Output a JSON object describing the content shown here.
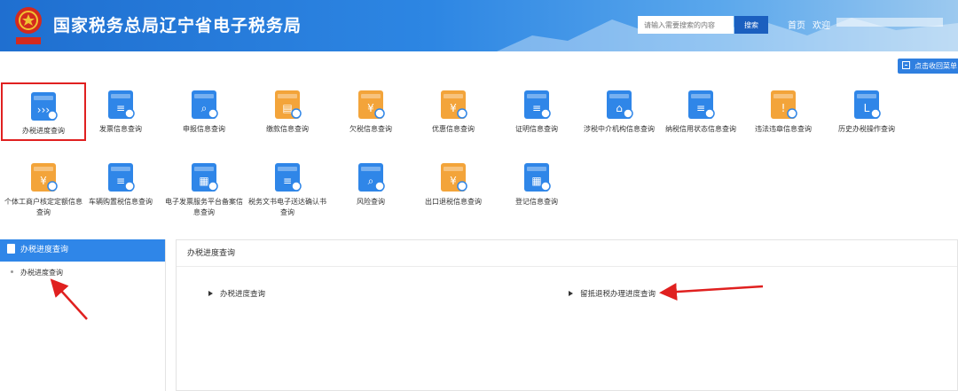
{
  "header": {
    "title": "国家税务总局辽宁省电子税务局",
    "emblem_text": "国家税务",
    "search_placeholder": "请输入需要搜索的内容",
    "search_button": "搜索",
    "nav_home": "首页",
    "nav_welcome": "欢迎"
  },
  "collapse_label": "点击收回菜单",
  "grid_items": [
    {
      "label": "办税进度查询",
      "icon": "progress-query-icon",
      "selected": true
    },
    {
      "label": "发票信息查询",
      "icon": "invoice-query-icon"
    },
    {
      "label": "申报信息查询",
      "icon": "declaration-query-icon"
    },
    {
      "label": "缴款信息查询",
      "icon": "payment-query-icon"
    },
    {
      "label": "欠税信息查询",
      "icon": "tax-arrears-query-icon"
    },
    {
      "label": "优惠信息查询",
      "icon": "preferential-query-icon"
    },
    {
      "label": "证明信息查询",
      "icon": "certificate-query-icon"
    },
    {
      "label": "涉税中介机构信息查询",
      "icon": "tax-agency-query-icon"
    },
    {
      "label": "纳税信用状态信息查询",
      "icon": "credit-status-query-icon"
    },
    {
      "label": "违法违章信息查询",
      "icon": "violation-query-icon"
    },
    {
      "label": "历史办税操作查询",
      "icon": "history-operation-icon"
    },
    {
      "label": "个体工商户核定定额信息查询",
      "icon": "individual-business-icon"
    },
    {
      "label": "车辆购置税信息查询",
      "icon": "vehicle-tax-icon"
    },
    {
      "label": "电子发票服务平台备案信息查询",
      "icon": "e-invoice-filing-icon"
    },
    {
      "label": "税务文书电子送达确认书查询",
      "icon": "e-delivery-document-icon"
    },
    {
      "label": "风险查询",
      "icon": "risk-query-icon"
    },
    {
      "label": "出口退税信息查询",
      "icon": "export-rebate-icon"
    },
    {
      "label": "登记信息查询",
      "icon": "registration-query-icon"
    }
  ],
  "left_panel": {
    "header": "办税进度查询",
    "items": [
      "办税进度查询"
    ]
  },
  "content": {
    "title": "办税进度查询",
    "links": [
      "办税进度查询",
      "留抵退税办理进度查询"
    ]
  },
  "colors": {
    "header_blue": "#2d86e3",
    "accent_blue": "#2f86e8",
    "selected_outline": "#e02020",
    "annotation_arrow": "#e0201f"
  }
}
